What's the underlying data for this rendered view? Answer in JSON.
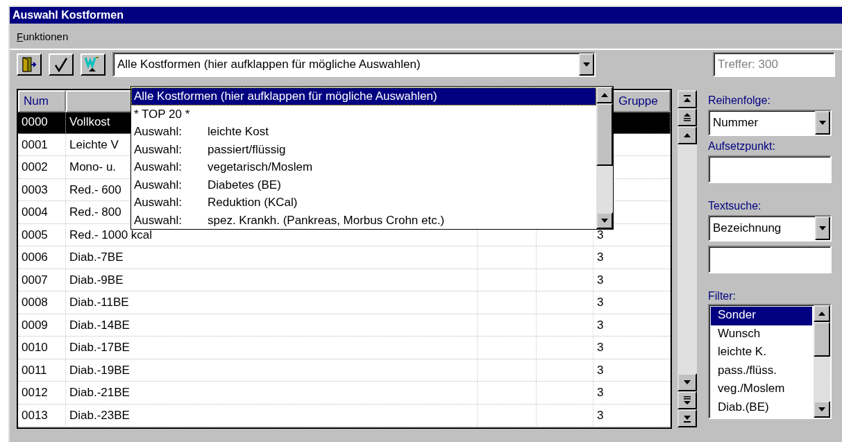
{
  "window": {
    "title": "Auswahl Kostformen"
  },
  "menu": [
    "Funktionen"
  ],
  "toolbar": {
    "combo": {
      "value": "Alle Kostformen (hier aufklappen für mögliche Auswahlen)",
      "expanded": true
    },
    "hits": {
      "value": "Treffer: 300",
      "disabled": true
    }
  },
  "dropdown": {
    "items": [
      {
        "label": "Alle Kostformen (hier aufklappen für mögliche Auswahlen)",
        "selected": true
      },
      {
        "label": "* TOP 20 *",
        "selected": false
      },
      {
        "prefix": "Auswahl:",
        "label": "leichte Kost",
        "selected": false
      },
      {
        "prefix": "Auswahl:",
        "label": "passiert/flüssig",
        "selected": false
      },
      {
        "prefix": "Auswahl:",
        "label": "vegetarisch/Moslem",
        "selected": false
      },
      {
        "prefix": "Auswahl:",
        "label": "Diabetes (BE)",
        "selected": false
      },
      {
        "prefix": "Auswahl:",
        "label": "Reduktion (KCal)",
        "selected": false
      },
      {
        "prefix": "Auswahl:",
        "label": "spez. Krankh. (Pankreas, Morbus Crohn etc.)",
        "selected": false
      }
    ]
  },
  "table": {
    "columns": {
      "column_1": "Num",
      "column_5": "Gruppe"
    },
    "rows": [
      {
        "num": "0000",
        "name": "Vollkost",
        "selected": true
      },
      {
        "num": "0001",
        "name": "Leichte V",
        "selected": false
      },
      {
        "num": "0002",
        "name": "Mono- u.",
        "selected": false
      },
      {
        "num": "0003",
        "name": "Red.- 600",
        "selected": false
      },
      {
        "num": "0004",
        "name": "Red.- 800",
        "selected": false
      },
      {
        "num": "0005",
        "name": "Red.- 1000 kcal",
        "group": "3",
        "selected": false
      },
      {
        "num": "0006",
        "name": "Diab.-7BE",
        "group": "3",
        "selected": false
      },
      {
        "num": "0007",
        "name": "Diab.-9BE",
        "group": "3",
        "selected": false
      },
      {
        "num": "0008",
        "name": "Diab.-11BE",
        "group": "3",
        "selected": false
      },
      {
        "num": "0009",
        "name": "Diab.-14BE",
        "group": "3",
        "selected": false
      },
      {
        "num": "0010",
        "name": "Diab.-17BE",
        "group": "3",
        "selected": false
      },
      {
        "num": "0011",
        "name": "Diab.-19BE",
        "group": "3",
        "selected": false
      },
      {
        "num": "0012",
        "name": "Diab.-21BE",
        "group": "3",
        "selected": false
      },
      {
        "num": "0013",
        "name": "Diab.-23BE",
        "group": "3",
        "selected": false
      }
    ]
  },
  "side": {
    "order": {
      "label": "Reihenfolge:",
      "value": "Nummer"
    },
    "start": {
      "label": "Aufsetzpunkt:"
    },
    "textsearch": {
      "label": "Textsuche:",
      "value": "Bezeichnung"
    },
    "filter": {
      "label": "Filter:",
      "items": [
        {
          "label": "Sonder",
          "selected": true
        },
        {
          "label": "Wunsch",
          "selected": false
        },
        {
          "label": "leichte K.",
          "selected": false
        },
        {
          "label": "pass./flüss.",
          "selected": false
        },
        {
          "label": "veg./Moslem",
          "selected": false
        },
        {
          "label": "Diab.(BE)",
          "selected": false
        }
      ]
    }
  }
}
